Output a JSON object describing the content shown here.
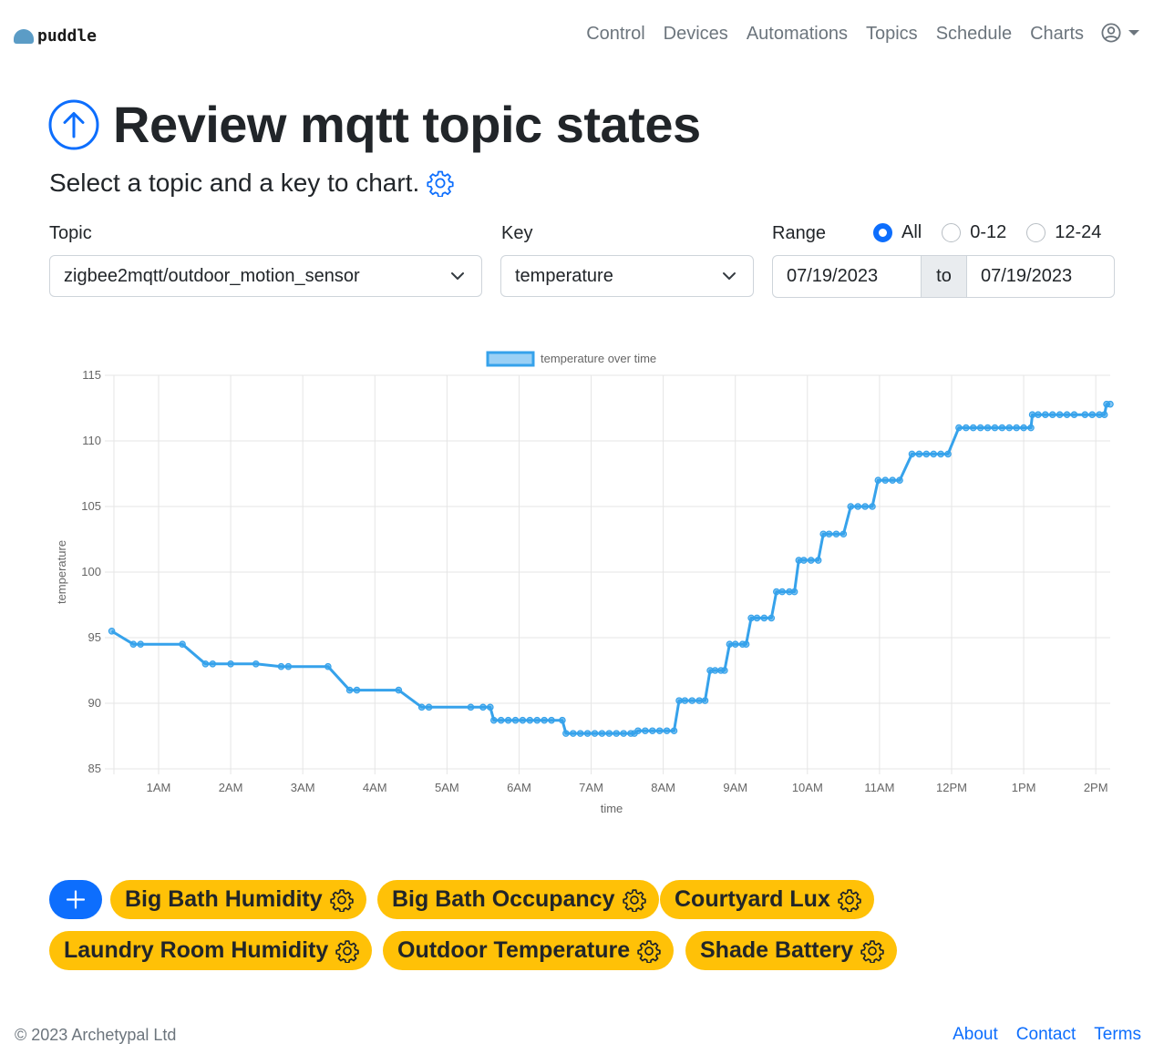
{
  "brand": {
    "name": "puddle"
  },
  "nav": {
    "items": [
      "Control",
      "Devices",
      "Automations",
      "Topics",
      "Schedule",
      "Charts"
    ],
    "user_icon": "person-circle-icon"
  },
  "page": {
    "title": "Review mqtt topic states",
    "title_icon": "arrow-up-circle-icon",
    "subtitle": "Select a topic and a key to chart.",
    "subtitle_icon": "gear-icon"
  },
  "form": {
    "topic_label": "Topic",
    "topic_value": "zigbee2mqtt/outdoor_motion_sensor",
    "key_label": "Key",
    "key_value": "temperature",
    "range_label": "Range",
    "range_options": [
      "All",
      "0-12",
      "12-24"
    ],
    "range_selected": "All",
    "date_from": "07/19/2023",
    "date_to_label": "to",
    "date_to": "07/19/2023"
  },
  "chart_data": {
    "type": "line",
    "legend": "temperature over time",
    "legend_position": "top",
    "xlabel": "time",
    "ylabel": "temperature",
    "ylim": [
      85,
      115
    ],
    "yticks": [
      115,
      110,
      105,
      100,
      95,
      90,
      85
    ],
    "xlim_hours": [
      0.33,
      14.2
    ],
    "xticks": [
      {
        "h": 1,
        "label": "1AM"
      },
      {
        "h": 2,
        "label": "2AM"
      },
      {
        "h": 3,
        "label": "3AM"
      },
      {
        "h": 4,
        "label": "4AM"
      },
      {
        "h": 5,
        "label": "5AM"
      },
      {
        "h": 6,
        "label": "6AM"
      },
      {
        "h": 7,
        "label": "7AM"
      },
      {
        "h": 8,
        "label": "8AM"
      },
      {
        "h": 9,
        "label": "9AM"
      },
      {
        "h": 10,
        "label": "10AM"
      },
      {
        "h": 11,
        "label": "11AM"
      },
      {
        "h": 12,
        "label": "12PM"
      },
      {
        "h": 13,
        "label": "1PM"
      },
      {
        "h": 14,
        "label": "2PM"
      }
    ],
    "grid": true,
    "color": "#36a2eb",
    "points": [
      [
        0.35,
        95.5
      ],
      [
        0.65,
        94.5
      ],
      [
        0.75,
        94.5
      ],
      [
        1.33,
        94.5
      ],
      [
        1.65,
        93.0
      ],
      [
        1.75,
        93.0
      ],
      [
        2.0,
        93.0
      ],
      [
        2.35,
        93.0
      ],
      [
        2.7,
        92.8
      ],
      [
        2.8,
        92.8
      ],
      [
        3.35,
        92.8
      ],
      [
        3.65,
        91.0
      ],
      [
        3.75,
        91.0
      ],
      [
        4.33,
        91.0
      ],
      [
        4.65,
        89.7
      ],
      [
        4.75,
        89.7
      ],
      [
        5.33,
        89.7
      ],
      [
        5.5,
        89.7
      ],
      [
        5.6,
        89.7
      ],
      [
        5.65,
        88.7
      ],
      [
        5.75,
        88.7
      ],
      [
        5.85,
        88.7
      ],
      [
        5.95,
        88.7
      ],
      [
        6.05,
        88.7
      ],
      [
        6.15,
        88.7
      ],
      [
        6.25,
        88.7
      ],
      [
        6.35,
        88.7
      ],
      [
        6.45,
        88.7
      ],
      [
        6.6,
        88.7
      ],
      [
        6.65,
        87.7
      ],
      [
        6.75,
        87.7
      ],
      [
        6.85,
        87.7
      ],
      [
        6.95,
        87.7
      ],
      [
        7.05,
        87.7
      ],
      [
        7.15,
        87.7
      ],
      [
        7.25,
        87.7
      ],
      [
        7.35,
        87.7
      ],
      [
        7.45,
        87.7
      ],
      [
        7.55,
        87.7
      ],
      [
        7.6,
        87.7
      ],
      [
        7.65,
        87.9
      ],
      [
        7.75,
        87.9
      ],
      [
        7.85,
        87.9
      ],
      [
        7.95,
        87.9
      ],
      [
        8.05,
        87.9
      ],
      [
        8.15,
        87.9
      ],
      [
        8.22,
        90.2
      ],
      [
        8.3,
        90.2
      ],
      [
        8.4,
        90.2
      ],
      [
        8.5,
        90.2
      ],
      [
        8.58,
        90.2
      ],
      [
        8.65,
        92.5
      ],
      [
        8.72,
        92.5
      ],
      [
        8.8,
        92.5
      ],
      [
        8.85,
        92.5
      ],
      [
        8.92,
        94.5
      ],
      [
        9.0,
        94.5
      ],
      [
        9.1,
        94.5
      ],
      [
        9.15,
        94.5
      ],
      [
        9.22,
        96.5
      ],
      [
        9.3,
        96.5
      ],
      [
        9.4,
        96.5
      ],
      [
        9.5,
        96.5
      ],
      [
        9.57,
        98.5
      ],
      [
        9.65,
        98.5
      ],
      [
        9.75,
        98.5
      ],
      [
        9.82,
        98.5
      ],
      [
        9.88,
        100.9
      ],
      [
        9.95,
        100.9
      ],
      [
        10.05,
        100.9
      ],
      [
        10.15,
        100.9
      ],
      [
        10.22,
        102.9
      ],
      [
        10.3,
        102.9
      ],
      [
        10.4,
        102.9
      ],
      [
        10.5,
        102.9
      ],
      [
        10.6,
        105.0
      ],
      [
        10.7,
        105.0
      ],
      [
        10.8,
        105.0
      ],
      [
        10.9,
        105.0
      ],
      [
        10.98,
        107.0
      ],
      [
        11.08,
        107.0
      ],
      [
        11.18,
        107.0
      ],
      [
        11.28,
        107.0
      ],
      [
        11.45,
        109.0
      ],
      [
        11.55,
        109.0
      ],
      [
        11.65,
        109.0
      ],
      [
        11.75,
        109.0
      ],
      [
        11.85,
        109.0
      ],
      [
        11.95,
        109.0
      ],
      [
        12.1,
        111.0
      ],
      [
        12.2,
        111.0
      ],
      [
        12.3,
        111.0
      ],
      [
        12.4,
        111.0
      ],
      [
        12.5,
        111.0
      ],
      [
        12.6,
        111.0
      ],
      [
        12.7,
        111.0
      ],
      [
        12.8,
        111.0
      ],
      [
        12.9,
        111.0
      ],
      [
        13.0,
        111.0
      ],
      [
        13.1,
        111.0
      ],
      [
        13.12,
        112.0
      ],
      [
        13.2,
        112.0
      ],
      [
        13.3,
        112.0
      ],
      [
        13.4,
        112.0
      ],
      [
        13.5,
        112.0
      ],
      [
        13.6,
        112.0
      ],
      [
        13.7,
        112.0
      ],
      [
        13.85,
        112.0
      ],
      [
        13.95,
        112.0
      ],
      [
        14.05,
        112.0
      ],
      [
        14.12,
        112.0
      ],
      [
        14.15,
        112.8
      ],
      [
        14.2,
        112.8
      ]
    ]
  },
  "pills": {
    "add_label": "+",
    "items": [
      "Big Bath Humidity",
      "Big Bath Occupancy",
      "Courtyard Lux",
      "Laundry Room Humidity",
      "Outdoor Temperature",
      "Shade Battery"
    ]
  },
  "footer": {
    "copyright": "© 2023 Archetypal Ltd",
    "links": [
      "About",
      "Contact",
      "Terms"
    ]
  },
  "colors": {
    "primary": "#0d6efd",
    "pill": "#ffc107",
    "chart_line": "#36a2eb"
  }
}
